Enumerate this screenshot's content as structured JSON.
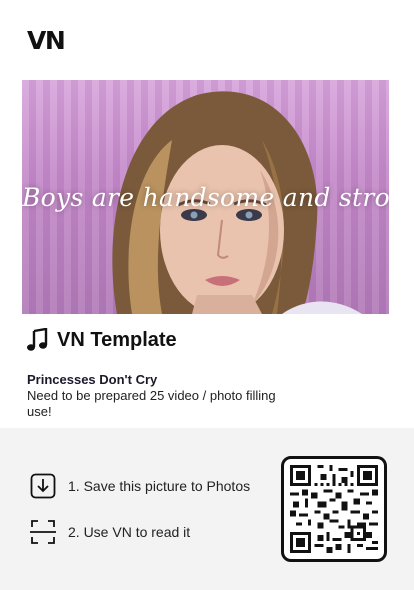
{
  "app": {
    "logo": "VN"
  },
  "cover": {
    "caption": "Boys are handsome and strong"
  },
  "template": {
    "header_icon": "music-note-icon",
    "title": "VN Template",
    "name": "Princesses Don't Cry",
    "description": "Need to be prepared 25 video / photo filling use!"
  },
  "steps": [
    {
      "icon": "download-icon",
      "label": "1. Save this picture to Photos"
    },
    {
      "icon": "scan-icon",
      "label": "2. Use VN to read it"
    }
  ],
  "qr": {
    "icon": "qr-code"
  },
  "colors": {
    "panel": "#f3f3f3",
    "text": "#111111",
    "cover_tint": "#c990cf"
  }
}
